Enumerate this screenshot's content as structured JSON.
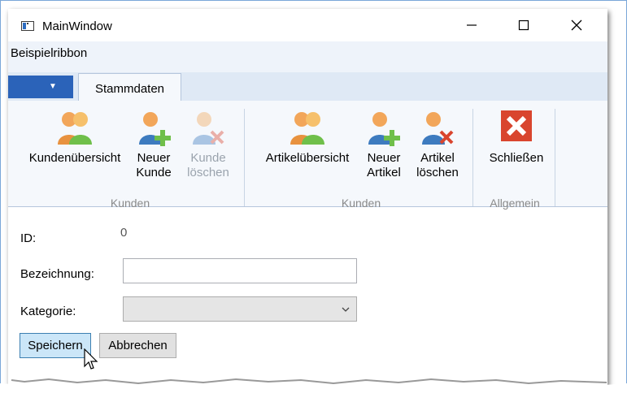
{
  "window": {
    "title": "MainWindow",
    "controls": {
      "minimize": "—",
      "maximize": "☐",
      "close": "✕"
    }
  },
  "ribbon": {
    "title": "Beispielribbon",
    "app_menu_glyph": "▼",
    "tabs": [
      {
        "label": "Stammdaten"
      }
    ],
    "groups": [
      {
        "label": "Kunden",
        "buttons": [
          {
            "label": "Kundenübersicht",
            "icon": "two-users-icon",
            "enabled": true
          },
          {
            "label_line1": "Neuer",
            "label_line2": "Kunde",
            "icon": "user-add-icon",
            "enabled": true
          },
          {
            "label_line1": "Kunde",
            "label_line2": "löschen",
            "icon": "user-delete-icon",
            "enabled": false
          }
        ]
      },
      {
        "label": "Kunden",
        "buttons": [
          {
            "label": "Artikelübersicht",
            "icon": "two-users-icon",
            "enabled": true
          },
          {
            "label_line1": "Neuer",
            "label_line2": "Artikel",
            "icon": "user-add-icon",
            "enabled": true
          },
          {
            "label_line1": "Artikel",
            "label_line2": "löschen",
            "icon": "user-delete-icon",
            "enabled": true
          }
        ]
      },
      {
        "label": "Allgemein",
        "buttons": [
          {
            "label": "Schließen",
            "icon": "close-red-icon",
            "enabled": true
          }
        ]
      }
    ]
  },
  "form": {
    "id_label": "ID:",
    "id_value": "0",
    "name_label": "Bezeichnung:",
    "name_value": "",
    "category_label": "Kategorie:",
    "category_value": "",
    "save_label": "Speichern",
    "cancel_label": "Abbrechen"
  },
  "colors": {
    "ribbon_bg": "#f5f8fc",
    "tabstrip_bg": "#dfe9f5",
    "app_menu": "#2b63b9",
    "save_button_bg": "#cbe6f8",
    "close_icon_red": "#d9452e"
  }
}
